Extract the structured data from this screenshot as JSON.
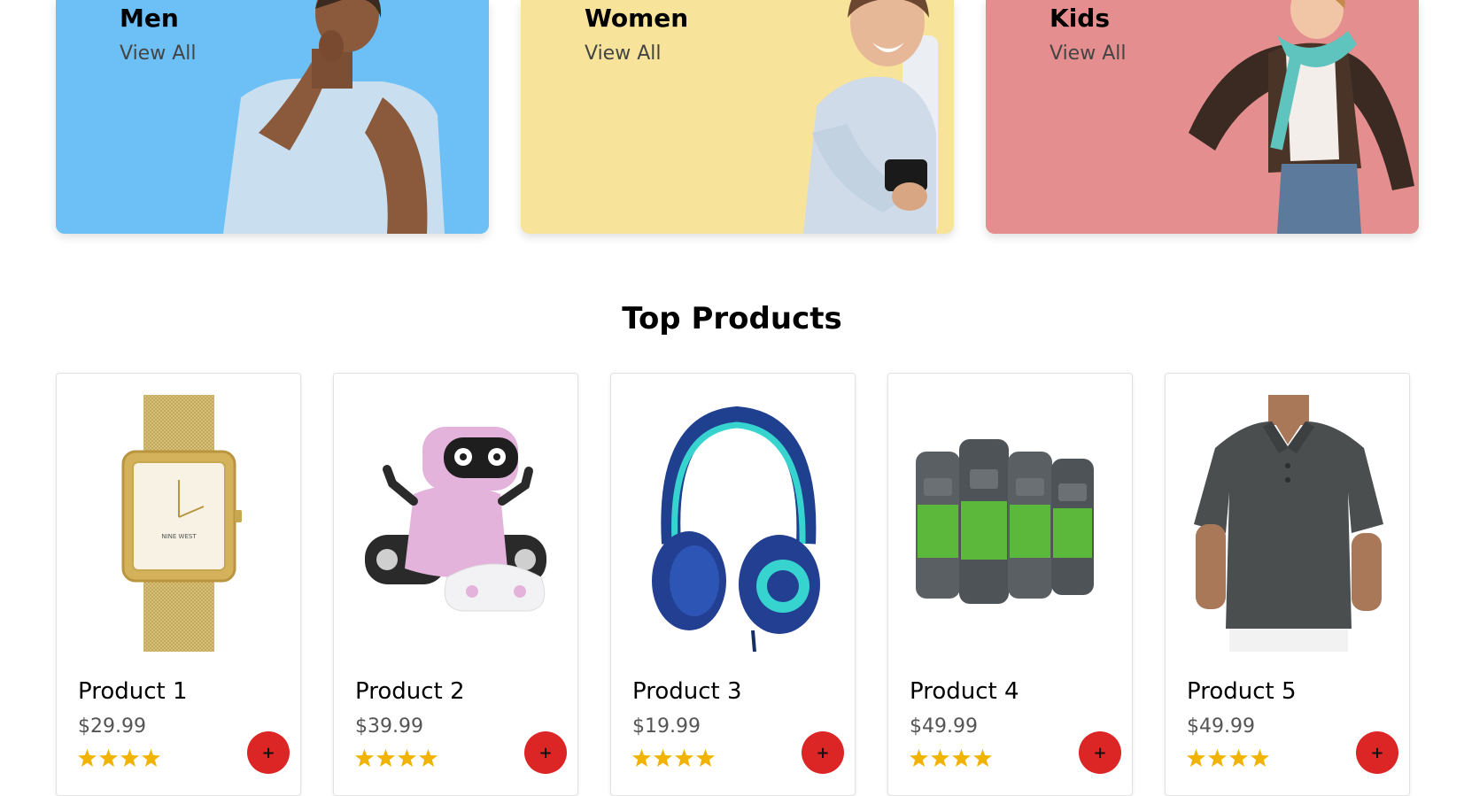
{
  "categories": [
    {
      "title": "Men",
      "link": "View All",
      "bg": "#6cc0f6"
    },
    {
      "title": "Women",
      "link": "View All",
      "bg": "#f7e49a"
    },
    {
      "title": "Kids",
      "link": "View All",
      "bg": "#e58e8f"
    }
  ],
  "section": {
    "title": "Top Products"
  },
  "products": [
    {
      "name": "Product 1",
      "price": "$29.99",
      "rating": 4,
      "add_label": "+",
      "image": "gold-watch-image"
    },
    {
      "name": "Product 2",
      "price": "$39.99",
      "rating": 4,
      "add_label": "+",
      "image": "pink-robot-toy-image"
    },
    {
      "name": "Product 3",
      "price": "$19.99",
      "rating": 4,
      "add_label": "+",
      "image": "blue-headphones-image"
    },
    {
      "name": "Product 4",
      "price": "$49.99",
      "rating": 4,
      "add_label": "+",
      "image": "body-wash-bottles-image"
    },
    {
      "name": "Product 5",
      "price": "$49.99",
      "rating": 4,
      "add_label": "+",
      "image": "gray-polo-shirt-image"
    }
  ],
  "colors": {
    "star": "#f0b400",
    "add_button": "#dc2626"
  }
}
